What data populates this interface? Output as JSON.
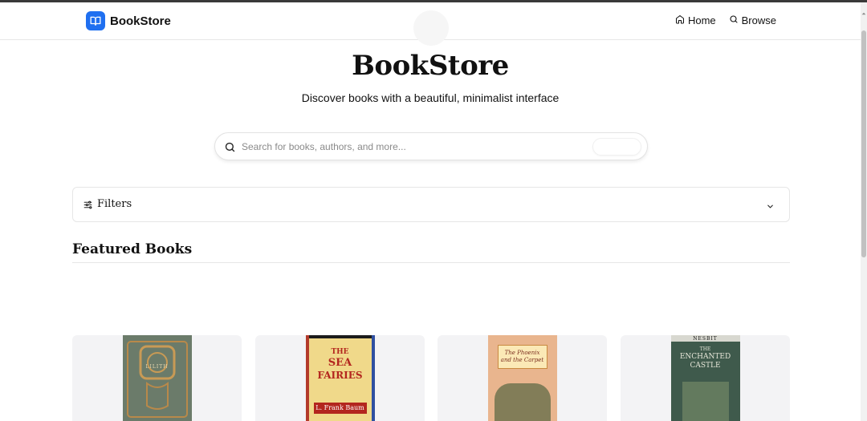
{
  "brand": {
    "name": "BookStore",
    "logo_icon": "open-book-icon",
    "accent": "#1f6ff0"
  },
  "nav": {
    "items": [
      {
        "label": "Home",
        "icon": "home-icon"
      },
      {
        "label": "Browse",
        "icon": "search-icon"
      }
    ]
  },
  "hero": {
    "title": "BookStore",
    "subtitle": "Discover books with a beautiful, minimalist interface"
  },
  "search": {
    "placeholder": "Search for books, authors, and more...",
    "value": "",
    "icon": "search-icon"
  },
  "filters": {
    "label": "Filters",
    "icon": "sliders-icon",
    "toggle_icon": "chevron-down-icon"
  },
  "featured": {
    "title": "Featured Books",
    "books": [
      {
        "cover_lines": [
          "LILITH"
        ],
        "cover_color": "#6b7b6a"
      },
      {
        "cover_lines": [
          "THE",
          "SEA",
          "FAIRIES",
          "L. Frank Baum"
        ],
        "cover_color": "#f0d98a"
      },
      {
        "cover_lines": [
          "The Phoenix",
          "and the Carpet"
        ],
        "cover_color": "#e9b58e"
      },
      {
        "cover_lines": [
          "NESBIT",
          "THE",
          "ENCHANTED",
          "CASTLE"
        ],
        "cover_color": "#3f5a4c"
      }
    ]
  }
}
